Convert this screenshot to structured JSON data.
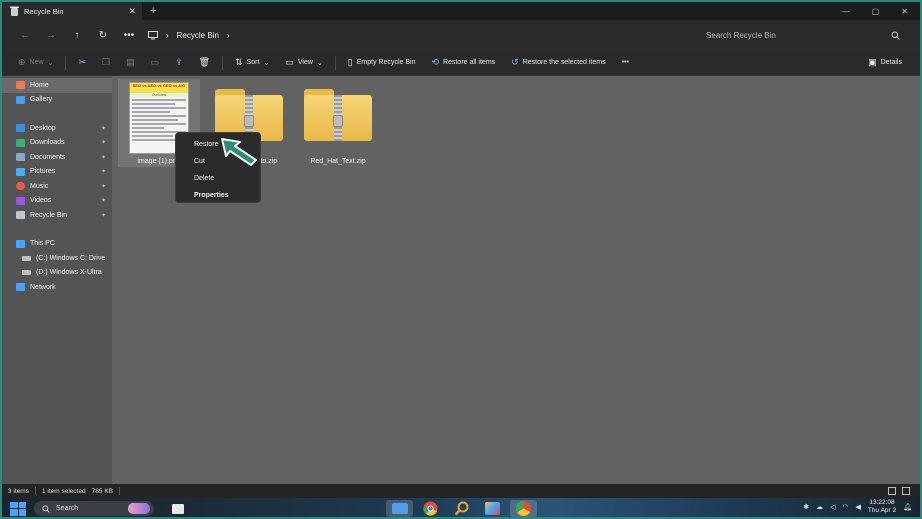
{
  "window": {
    "tab_title": "Recycle Bin",
    "tab_close": "✕",
    "new_tab": "+",
    "controls": {
      "minimize": "—",
      "maximize": "▢",
      "close": "✕"
    }
  },
  "address": {
    "back": "←",
    "forward": "→",
    "up": "↑",
    "refresh": "↻",
    "more": "•••",
    "breadcrumb_root_icon": "monitor-icon",
    "breadcrumb": "Recycle Bin",
    "chevron": "›",
    "search_placeholder": "Search Recycle Bin"
  },
  "toolbar": {
    "new_label": "New",
    "sort_label": "Sort",
    "view_label": "View",
    "empty_label": "Empty Recycle Bin",
    "restore_all_label": "Restore all items",
    "restore_selected_label": "Restore the selected items",
    "more_label": "•••",
    "details_label": "Details"
  },
  "sidebar": {
    "items": [
      {
        "label": "Home",
        "icon": "home-icon",
        "color": "#e87a5a"
      },
      {
        "label": "Gallery",
        "icon": "gallery-icon",
        "color": "#4f9ee8"
      },
      {
        "label": "Desktop",
        "icon": "desktop-icon",
        "color": "#3d8fe0"
      },
      {
        "label": "Downloads",
        "icon": "downloads-icon",
        "color": "#3bb07a"
      },
      {
        "label": "Documents",
        "icon": "documents-icon",
        "color": "#8aa6c8"
      },
      {
        "label": "Pictures",
        "icon": "pictures-icon",
        "color": "#4ab0e8"
      },
      {
        "label": "Music",
        "icon": "music-icon",
        "color": "#e45a4a"
      },
      {
        "label": "Videos",
        "icon": "videos-icon",
        "color": "#9a5ae0"
      },
      {
        "label": "Recycle Bin",
        "icon": "recycle-bin-icon",
        "color": "#bfc7d0"
      },
      {
        "label": "This PC",
        "icon": "this-pc-icon",
        "color": "#4aa3ff"
      },
      {
        "label": "(C:) Windows C: Drive",
        "icon": "drive-icon",
        "color": "#c0c0c0"
      },
      {
        "label": "(D:) Windows X-Ultra",
        "icon": "drive-icon",
        "color": "#c0c0c0"
      },
      {
        "label": "Network",
        "icon": "network-icon",
        "color": "#4aa3ff"
      }
    ],
    "pin_glyph": "✦"
  },
  "files": [
    {
      "name": "image (1).png",
      "thumb_header": "SEO vs AEO vs GEO vs AIO",
      "thumb_sub": "Overview"
    },
    {
      "name": "photo.zip"
    },
    {
      "name": "Red_Hat_Text.zip"
    }
  ],
  "context_menu": {
    "items": [
      "Restore",
      "Cut",
      "Delete",
      "Properties"
    ]
  },
  "status": {
    "count": "3 items",
    "selection": "1 item selected",
    "size": "785 KB"
  },
  "taskbar": {
    "search_label": "Search",
    "time": "13:22:08",
    "date": "Thu Apr 2"
  },
  "colors": {
    "accent_frame": "#2d8a7f",
    "cursor_fill": "#2e8b7a",
    "folder": "#f0c85a"
  }
}
